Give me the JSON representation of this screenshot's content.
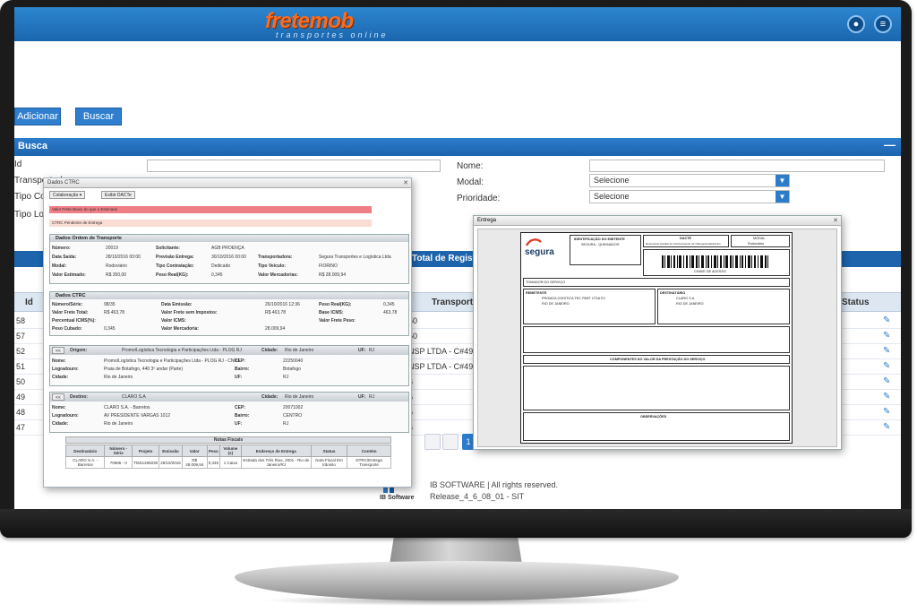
{
  "app": {
    "logo_main": "fretemob",
    "logo_sub": "transportes online",
    "user_icon": "user-icon",
    "menu_icon": "menu-icon"
  },
  "toolbar": {
    "add_label": "Adicionar",
    "search_label": "Buscar"
  },
  "busca": {
    "title": "Busca",
    "collapse": "—",
    "labels": {
      "id": "Id",
      "transportadora": "Transportad...",
      "tipo_comp": "Tipo Comp...",
      "tipo_loc": "Tipo Local...",
      "nome": "Nome:",
      "modal": "Modal:",
      "prioridade": "Prioridade:"
    },
    "modal_value": "Selecione",
    "prioridade_value": "Selecione"
  },
  "grid": {
    "total_label": "Total de Registros",
    "columns": {
      "id": "Id",
      "transportadora": "Transportad",
      "status": "Status"
    },
    "rows": [
      {
        "id": "58",
        "transp": "50"
      },
      {
        "id": "57",
        "transp": "50"
      },
      {
        "id": "52",
        "transp": "NSP LTDA - C#49"
      },
      {
        "id": "51",
        "transp": "NSP LTDA - C#49"
      },
      {
        "id": "50",
        "transp": "6"
      },
      {
        "id": "49",
        "transp": "6"
      },
      {
        "id": "48",
        "transp": "6"
      },
      {
        "id": "47",
        "transp": "6"
      }
    ],
    "page": "1"
  },
  "footer": {
    "company": "IB SOFTWARE | All rights reserved.",
    "release": "Release_4_6_08_01 - SIT",
    "logo_text": "IB Software"
  },
  "modal_ctrc": {
    "title": "Dados CTRC",
    "btn_colaboracao": "Colaboração ▾",
    "btn_exibir": "Exibir DACTe",
    "alert_red": "Valor Frete Baixo do que o Estimado",
    "alert_pink": "CTRC Pendente de Entrega",
    "sec_ordem": "Dados Ordem de Transporte",
    "ordem": {
      "numero_k": "Número:",
      "numero_v": "20019",
      "solicitante_k": "Solicitante:",
      "solicitante_v": "AGB PROENÇA",
      "data_saida_k": "Data Saída:",
      "data_saida_v": "28/10/2016 00:00",
      "previsao_k": "Previsão Entrega:",
      "previsao_v": "30/10/2016 00:00",
      "transportadora_k": "Transportadora:",
      "transportadora_v": "Segura Transportes e Logística Ltda",
      "modal_k": "Modal:",
      "modal_v": "Rodoviário",
      "tipo_contr_k": "Tipo Contratação:",
      "tipo_contr_v": "Dedicado",
      "tipo_veic_k": "Tipo Veículo:",
      "tipo_veic_v": "FIORINO",
      "valor_est_k": "Valor Estimado:",
      "valor_est_v": "R$ 350,00",
      "peso_k": "Peso Real(KG):",
      "peso_v": "0,345",
      "valor_merc_k": "Valor Mercadorias:",
      "valor_merc_v": "R$ 28.009,94"
    },
    "sec_ctrc": "Dados CTRC",
    "ctrc": {
      "numero_k": "Número/Série:",
      "numero_v": "98/35",
      "data_emissao_k": "Data Emissão:",
      "data_emissao_v": "26/10/2016 12:36",
      "peso_real_k": "Peso Real(KG):",
      "peso_real_v": "0,345",
      "valor_frete_k": "Valor Frete Total:",
      "valor_frete_v": "R$ 463,78",
      "valor_sem_imp_k": "Valor Frete sem Impostos:",
      "valor_sem_imp_v": "R$ 463,78",
      "base_icms_k": "Base ICMS:",
      "base_icms_v": "463,78",
      "perc_icms_k": "Percentual ICMS(%):",
      "perc_icms_v": "",
      "valor_icms_k": "Valor ICMS:",
      "valor_icms_v": "",
      "valor_frete_peso_k": "Valor Frete Peso:",
      "valor_frete_peso_v": "",
      "peso_cubado_k": "Peso Cubado:",
      "peso_cubado_v": "0,345",
      "valor_merc_k": "Valor Mercadoria:",
      "valor_merc_v": "28.009,94"
    },
    "origem": {
      "btn": "<<",
      "title_k": "Origem:",
      "title_v": "Promo/Logística Tecnologia e Participações Ltda - PLOG RJ",
      "cidade_k": "Cidade:",
      "cidade_v": "Rio de Janeiro",
      "uf_k": "UF:",
      "uf_v": "RJ",
      "nome_k": "Nome:",
      "nome_v": "Promo/Logística Tecnologia e Participações Ltda - PLOG RJ - CNPJ",
      "cep_k": "CEP:",
      "cep_v": "22250040",
      "logr_k": "Logradouro:",
      "logr_v": "Praia de Botafogo, 440 3º andar (Parte)",
      "bairro_k": "Bairro:",
      "bairro_v": "Botafogo",
      "cid_k": "Cidade:",
      "cid_v": "Rio de Janeiro",
      "uf2_k": "UF:",
      "uf2_v": "RJ"
    },
    "destino": {
      "btn": "<<",
      "title_k": "Destino:",
      "title_v": "CLARO S.A",
      "cidade_k": "Cidade:",
      "cidade_v": "Rio de Janeiro",
      "uf_k": "UF:",
      "uf_v": "RJ",
      "nome_k": "Nome:",
      "nome_v": "CLARO S.A. - Barretos",
      "cep_k": "CEP:",
      "cep_v": "20071002",
      "logr_k": "Logradouro:",
      "logr_v": "AV PRESIDENTE VARGAS 1012",
      "bairro_k": "Bairro:",
      "bairro_v": "CENTRO",
      "cid_k": "Cidade:",
      "cid_v": "Rio de Janeiro",
      "uf2_k": "UF:",
      "uf2_v": "RJ"
    },
    "notas": {
      "title": "Notas Fiscais",
      "headers": [
        "Destinatário",
        "Número - Série",
        "Projeto",
        "Emissão",
        "Valor",
        "Peso",
        "Volume (s)",
        "Endereço de Entrega",
        "Status",
        "Contém"
      ],
      "row": [
        "CLARO S.A. - Barretos",
        "70686 - 0",
        "TMS1266030",
        "26/10/2016",
        "R$ 28.009,94",
        "0,345",
        "1 Caixa",
        "Estrada dos Três Rios, 2001 - Rio de Janeiro/RJ",
        "Nota Fiscal Em trânsito",
        "DTRC/Entrega Transporte"
      ]
    }
  },
  "modal_entrega": {
    "title": "Entrega",
    "dacte": {
      "logo": "segura",
      "emitente": "IDENTIFICAÇÃO DO EMITENTE",
      "emitente_nome": "SEGURA - QUEIMADOS",
      "title": "DACTE",
      "title_sub": "Documento Auxiliar do Conhecimento de Transporte Eletrônico",
      "modal_label": "MODAL",
      "modal_value": "Rodoviário",
      "chave_label": "CHAVE DE ACESSO",
      "tomador_label": "TOMADOR DO SERVIÇO",
      "remetente_label": "REMETENTE",
      "remetente_v": "PROMO/LOGISTICA TEC PART LTDA RJ",
      "destinatario_label": "DESTINATÁRIO",
      "destinatario_v": "CLARO S.A",
      "componentes_label": "COMPONENTES DO VALOR DA PRESTAÇÃO DO SERVIÇO",
      "obs_label": "OBSERVAÇÕES",
      "municipio": "RIO DE JANEIRO"
    }
  }
}
